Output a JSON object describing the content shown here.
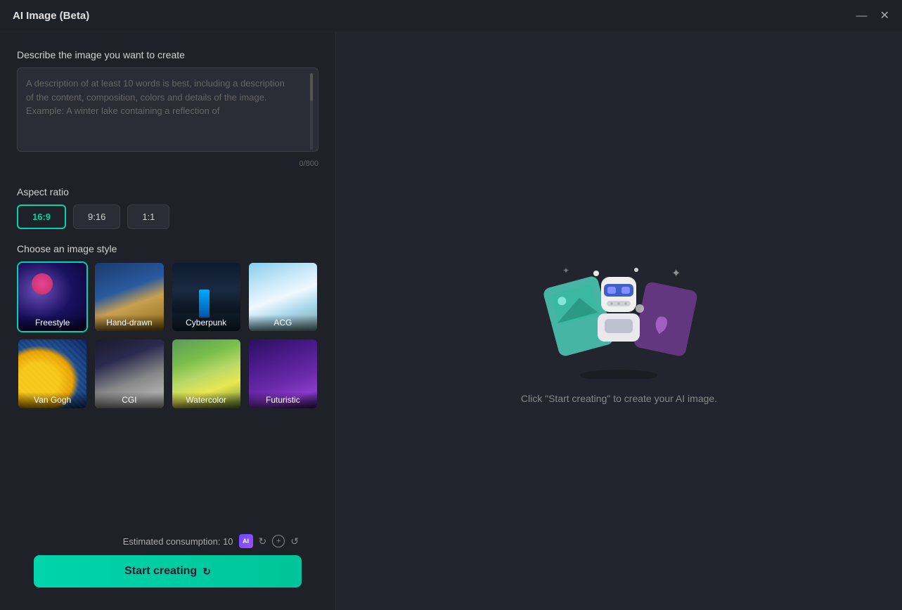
{
  "window": {
    "title": "AI Image (Beta)"
  },
  "titlebar": {
    "minimize_label": "—",
    "close_label": "✕"
  },
  "left": {
    "describe_label": "Describe the image you want to create",
    "textarea_placeholder": "A description of at least 10 words is best, including a description of the content, composition, colors and details of the image.\nExample: A winter lake containing a reflection of",
    "char_count": "0/800",
    "aspect_ratio_label": "Aspect ratio",
    "aspect_options": [
      {
        "value": "16:9",
        "active": true
      },
      {
        "value": "9:16",
        "active": false
      },
      {
        "value": "1:1",
        "active": false
      }
    ],
    "style_label": "Choose an image style",
    "styles": [
      {
        "id": "freestyle",
        "label": "Freestyle",
        "selected": true
      },
      {
        "id": "handdrawn",
        "label": "Hand-drawn",
        "selected": false
      },
      {
        "id": "cyberpunk",
        "label": "Cyberpunk",
        "selected": false
      },
      {
        "id": "acg",
        "label": "ACG",
        "selected": false
      },
      {
        "id": "vangogh",
        "label": "Van Gogh",
        "selected": false
      },
      {
        "id": "cgi",
        "label": "CGI",
        "selected": false
      },
      {
        "id": "watercolor",
        "label": "Watercolor",
        "selected": false
      },
      {
        "id": "futuristic",
        "label": "Futuristic",
        "selected": false
      }
    ]
  },
  "bottom": {
    "consumption_label": "Estimated consumption: 10",
    "ai_badge": "AI",
    "start_btn_label": "Start creating"
  },
  "right": {
    "placeholder_text": "Click \"Start creating\" to create your AI image."
  }
}
